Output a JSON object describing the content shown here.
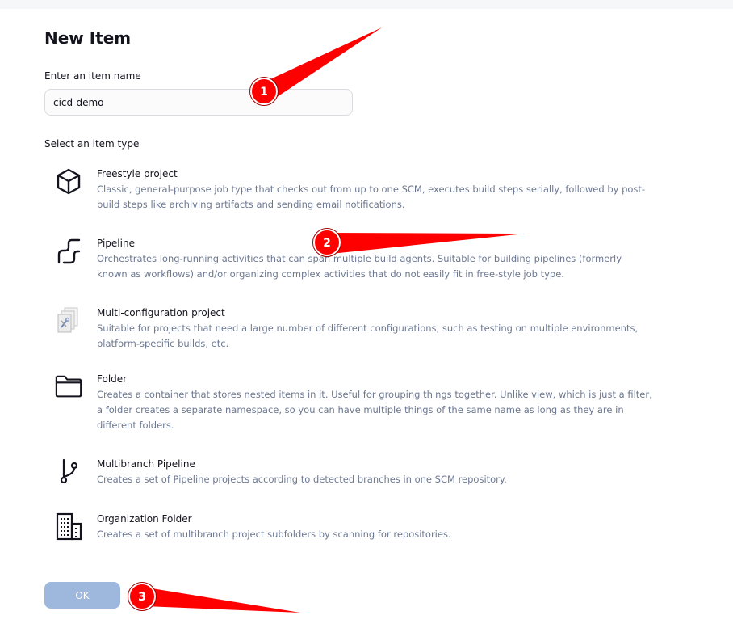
{
  "page": {
    "title": "New Item"
  },
  "form": {
    "name_label": "Enter an item name",
    "name_value": "cicd-demo",
    "type_label": "Select an item type",
    "ok_label": "OK"
  },
  "item_types": [
    {
      "title": "Freestyle project",
      "description": "Classic, general-purpose job type that checks out from up to one SCM, executes build steps serially, followed by post-build steps like archiving artifacts and sending email notifications.",
      "icon": "cube-icon"
    },
    {
      "title": "Pipeline",
      "description": "Orchestrates long-running activities that can span multiple build agents. Suitable for building pipelines (formerly known as workflows) and/or organizing complex activities that do not easily fit in free-style job type.",
      "icon": "pipeline-icon"
    },
    {
      "title": "Multi-configuration project",
      "description": "Suitable for projects that need a large number of different configurations, such as testing on multiple environments, platform-specific builds, etc.",
      "icon": "multi-config-icon"
    },
    {
      "title": "Folder",
      "description": "Creates a container that stores nested items in it. Useful for grouping things together. Unlike view, which is just a filter, a folder creates a separate namespace, so you can have multiple things of the same name as long as they are in different folders.",
      "icon": "folder-icon"
    },
    {
      "title": "Multibranch Pipeline",
      "description": "Creates a set of Pipeline projects according to detected branches in one SCM repository.",
      "icon": "branch-icon"
    },
    {
      "title": "Organization Folder",
      "description": "Creates a set of multibranch project subfolders by scanning for repositories.",
      "icon": "building-icon"
    }
  ],
  "annotations": {
    "badge_1": "1",
    "badge_2": "2",
    "badge_3": "3"
  },
  "colors": {
    "accent_red": "#ff0000",
    "ok_button": "#9eb7dd",
    "description_text": "#6c7891"
  }
}
